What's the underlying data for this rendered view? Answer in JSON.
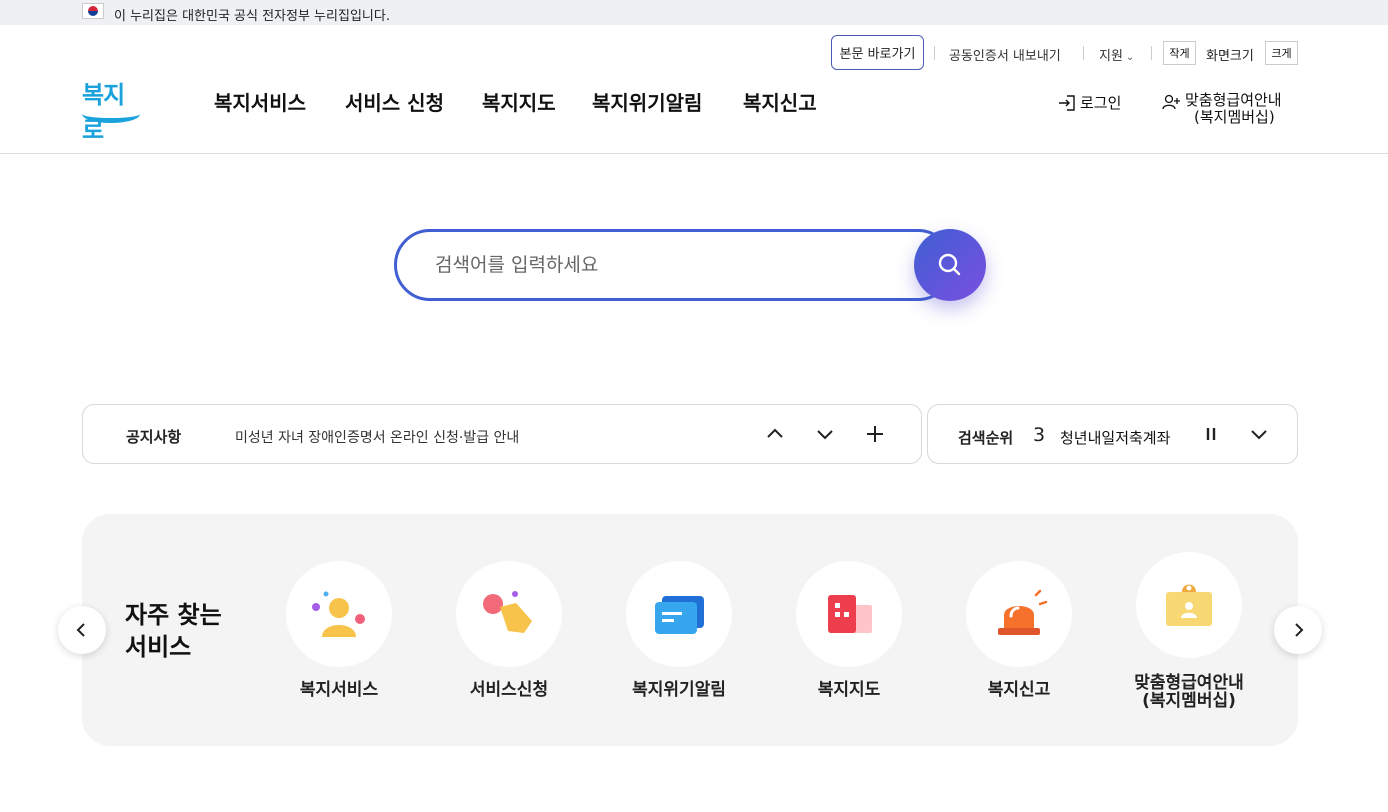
{
  "gov_banner": {
    "text": "이 누리집은 대한민국 공식 전자정부 누리집입니다."
  },
  "header": {
    "logo_text": "복지로",
    "utility": {
      "skip_label": "본문 바로가기",
      "cert_label": "공동인증서 내보내기",
      "support_label": "지원",
      "zoom_small": "작게",
      "zoom_label": "화면크기",
      "zoom_large": "크게"
    },
    "nav": [
      "복지서비스",
      "서비스 신청",
      "복지지도",
      "복지위기알림",
      "복지신고"
    ],
    "login_label": "로그인",
    "member_line1": "맞춤형급여안내",
    "member_line2": "(복지멤버십)"
  },
  "search": {
    "placeholder": "검색어를 입력하세요"
  },
  "notice": {
    "label": "공지사항",
    "text": "미성년 자녀 장애인증명서 온라인 신청·발급 안내"
  },
  "rank": {
    "label": "검색순위",
    "number": "3",
    "keyword": "청년내일저축계좌"
  },
  "frequent": {
    "title_line1": "자주 찾는",
    "title_line2": "서비스",
    "items": [
      {
        "label": "복지서비스",
        "icon": "person-icon"
      },
      {
        "label": "서비스신청",
        "icon": "hand-click-icon"
      },
      {
        "label": "복지위기알림",
        "icon": "message-icon"
      },
      {
        "label": "복지지도",
        "icon": "building-icon"
      },
      {
        "label": "복지신고",
        "icon": "siren-icon"
      },
      {
        "label_line1": "맞춤형급여안내",
        "label_line2": "(복지멤버십)",
        "icon": "membership-card-icon"
      }
    ]
  },
  "colors": {
    "brand_blue": "#3f5fd2",
    "brand_purple": "#7a4fe0",
    "logo_blue": "#1aa2dc"
  }
}
